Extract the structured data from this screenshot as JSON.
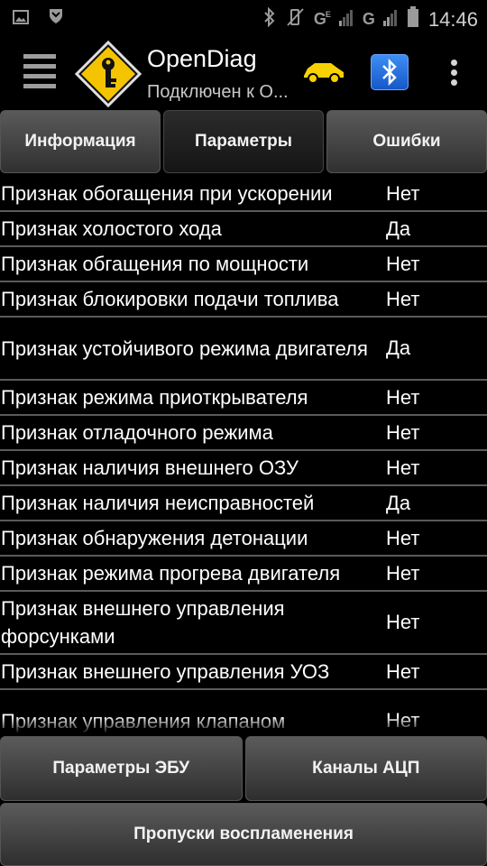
{
  "status_bar": {
    "time": "14:46",
    "network_label": "G",
    "network_label_2": "G",
    "network_small": "E"
  },
  "header": {
    "title": "OpenDiag",
    "subtitle": "Подключен к О...",
    "logo_icon": "key-warning-sign-icon",
    "car_icon": "car-icon",
    "bluetooth_icon": "bluetooth-icon",
    "colors": {
      "logo_yellow": "#f4c400",
      "car_yellow": "#f8d200",
      "bluetooth_blue": "#2a74e6"
    }
  },
  "tabs": [
    {
      "label": "Информация",
      "active": false
    },
    {
      "label": "Параметры",
      "active": true
    },
    {
      "label": "Ошибки",
      "active": false
    }
  ],
  "params": [
    {
      "name": "Признак обогащения при ускорении",
      "value": "Нет",
      "lines": 1
    },
    {
      "name": "Признак холостого хода",
      "value": "Да",
      "lines": 1
    },
    {
      "name": "Признак обгащения по мощности",
      "value": "Нет",
      "lines": 1
    },
    {
      "name": "Признак блокировки подачи топлива",
      "value": "Нет",
      "lines": 1
    },
    {
      "name": "Признак устойчивого режима двигателя",
      "value": "Да",
      "lines": 2
    },
    {
      "name": "Признак режима приоткрывателя",
      "value": "Нет",
      "lines": 1
    },
    {
      "name": "Признак отладочного режима",
      "value": "Нет",
      "lines": 1
    },
    {
      "name": "Признак наличия внешнего ОЗУ",
      "value": "Нет",
      "lines": 1
    },
    {
      "name": "Признак наличия неисправностей",
      "value": "Да",
      "lines": 1
    },
    {
      "name": "Признак обнаружения детонации",
      "value": "Нет",
      "lines": 1
    },
    {
      "name": "Признак режима прогрева двигателя",
      "value": "Нет",
      "lines": 1
    },
    {
      "name": "Признак внешнего управления форсунками",
      "value": "Нет",
      "lines": 2
    },
    {
      "name": "Признак внешнего управления УОЗ",
      "value": "Нет",
      "lines": 1
    },
    {
      "name": "Признак управления клапаном",
      "value": "Нет",
      "lines": 2
    }
  ],
  "bottom_buttons": {
    "ecu_params": "Параметры ЭБУ",
    "adc_channels": "Каналы АЦП",
    "misfires": "Пропуски воспламенения"
  }
}
